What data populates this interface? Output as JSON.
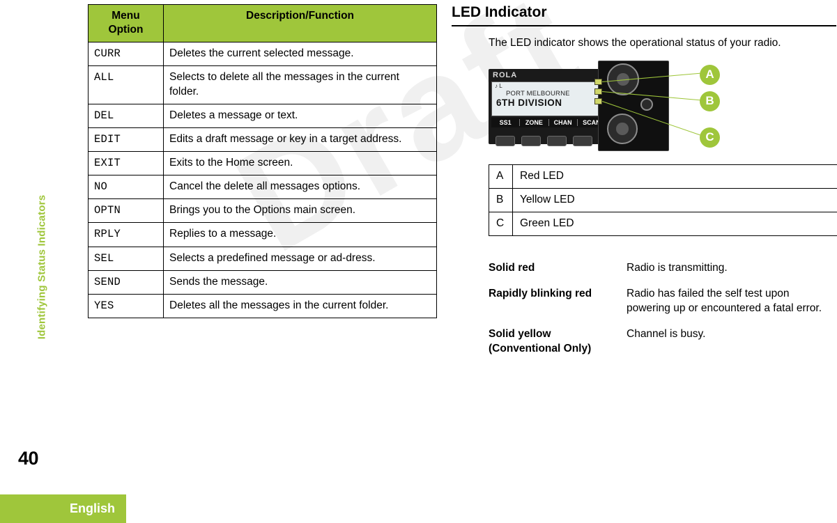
{
  "sidebar": {
    "vertical_tab": "Identifying Status Indicators",
    "page_number": "40",
    "language": "English"
  },
  "watermark": "Draft",
  "menu_table": {
    "headers": [
      "Menu Option",
      "Description/Function"
    ],
    "rows": [
      {
        "option": "CURR",
        "description": "Deletes the current selected message."
      },
      {
        "option": "ALL",
        "description": "Selects to delete all the messages in the current folder."
      },
      {
        "option": "DEL",
        "description": "Deletes a message or text."
      },
      {
        "option": "EDIT",
        "description": "Edits a draft message or key in a target address."
      },
      {
        "option": "EXIT",
        "description": "Exits to the Home screen."
      },
      {
        "option": "NO",
        "description": "Cancel the delete all messages options."
      },
      {
        "option": "OPTN",
        "description": "Brings you to the Options main screen."
      },
      {
        "option": "RPLY",
        "description": "Replies to a message."
      },
      {
        "option": "SEL",
        "description": "Selects a predefined message or ad-dress."
      },
      {
        "option": "SEND",
        "description": "Sends the message."
      },
      {
        "option": "YES",
        "description": "Deletes all the messages in the current folder."
      }
    ]
  },
  "led_section": {
    "title": "LED Indicator",
    "intro": "The LED indicator shows the operational status of your radio.",
    "radio": {
      "brand_text": "ROLA",
      "lcd_line1": "♪ L",
      "lcd_line2": "PORT MELBOURNE",
      "lcd_line3": "6TH DIVISION",
      "softkeys": [
        "SS1",
        "ZONE",
        "CHAN",
        "SCAN"
      ],
      "callouts": [
        "A",
        "B",
        "C"
      ]
    },
    "legend": [
      {
        "key": "A",
        "label": "Red LED"
      },
      {
        "key": "B",
        "label": "Yellow LED"
      },
      {
        "key": "C",
        "label": "Green LED"
      }
    ],
    "statuses": [
      {
        "term": "Solid red",
        "meaning": "Radio is transmitting."
      },
      {
        "term": "Rapidly blinking red",
        "meaning": "Radio has failed the self test upon powering up or encountered a fatal error."
      },
      {
        "term": "Solid yellow (Conventional Only)",
        "meaning": "Channel is busy."
      }
    ]
  },
  "colors": {
    "accent": "#9fc63b",
    "text": "#000000"
  }
}
